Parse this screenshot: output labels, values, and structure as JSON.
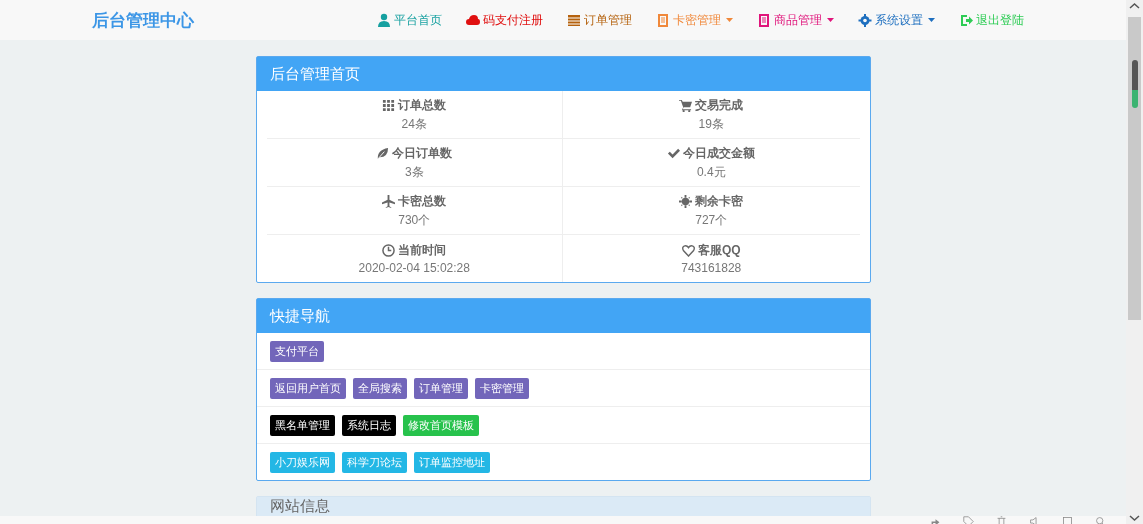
{
  "brand": "后台管理中心",
  "nav": [
    {
      "label": "平台首页",
      "color": "#16a0a0",
      "caret": false
    },
    {
      "label": "码支付注册",
      "color": "#e01010",
      "caret": false
    },
    {
      "label": "订单管理",
      "color": "#b5620e",
      "caret": false
    },
    {
      "label": "卡密管理",
      "color": "#f0883a",
      "caret": true
    },
    {
      "label": "商品管理",
      "color": "#e0157b",
      "caret": true
    },
    {
      "label": "系统设置",
      "color": "#1e6fbf",
      "caret": true
    },
    {
      "label": "退出登陆",
      "color": "#2ecc55",
      "caret": false
    }
  ],
  "overview": {
    "title": "后台管理首页",
    "stats": [
      {
        "label": "订单总数",
        "value": "24条"
      },
      {
        "label": "交易完成",
        "value": "19条"
      },
      {
        "label": "今日订单数",
        "value": "3条"
      },
      {
        "label": "今日成交金额",
        "value": "0.4元"
      },
      {
        "label": "卡密总数",
        "value": "730个"
      },
      {
        "label": "剩余卡密",
        "value": "727个"
      },
      {
        "label": "当前时间",
        "value": "2020-02-04 15:02:28"
      },
      {
        "label": "客服QQ",
        "value": "743161828"
      }
    ]
  },
  "quick_nav": {
    "title": "快捷导航",
    "rows": [
      [
        {
          "label": "支付平台",
          "color": "#7266ba"
        }
      ],
      [
        {
          "label": "返回用户首页",
          "color": "#7266ba"
        },
        {
          "label": "全局搜索",
          "color": "#7266ba"
        },
        {
          "label": "订单管理",
          "color": "#7266ba"
        },
        {
          "label": "卡密管理",
          "color": "#7266ba"
        }
      ],
      [
        {
          "label": "黑名单管理",
          "color": "#000000"
        },
        {
          "label": "系统日志",
          "color": "#000000"
        },
        {
          "label": "修改首页模板",
          "color": "#27c24c"
        }
      ],
      [
        {
          "label": "小刀娱乐网",
          "color": "#23b7e5"
        },
        {
          "label": "科学刀论坛",
          "color": "#23b7e5"
        },
        {
          "label": "订单监控地址",
          "color": "#23b7e5"
        }
      ]
    ]
  },
  "site_info": {
    "title": "网站信息"
  }
}
